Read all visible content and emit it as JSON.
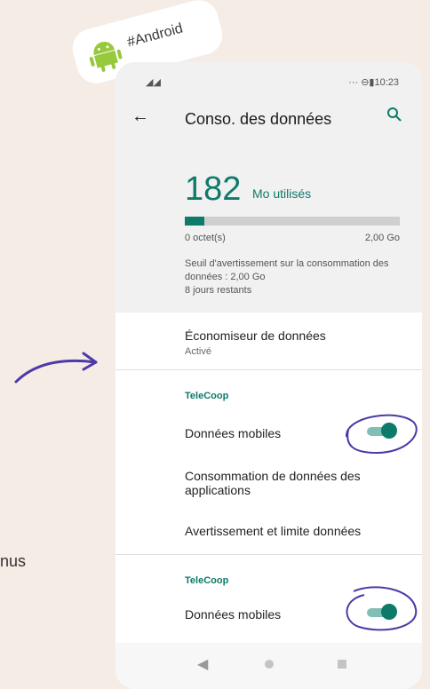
{
  "sticker": {
    "label": "#Android"
  },
  "side_text": "nus",
  "status": {
    "right": "··· ⊖▮10:23",
    "signal": "◢◢"
  },
  "appbar": {
    "title": "Conso. des données"
  },
  "usage": {
    "amount": "182",
    "unit": "Mo utilisés",
    "progress_fraction": 0.09,
    "min_label": "0 octet(s)",
    "max_label": "2,00 Go",
    "warning": "Seuil d'avertissement sur la consommation des données : 2,00 Go",
    "days_left": "8 jours restants"
  },
  "saver": {
    "label": "Économiseur de données",
    "status": "Activé"
  },
  "section1": {
    "header": "TeleCoop",
    "mobile_data": "Données mobiles",
    "toggle_on": true
  },
  "app_usage": "Consommation de données des applications",
  "warning_limit": "Avertissement et limite données",
  "section2": {
    "header": "TeleCoop",
    "mobile_data": "Données mobiles",
    "toggle_on": true
  },
  "colors": {
    "accent": "#0d7a6a",
    "background": "#f6ece6",
    "annotation": "#4b3aa8"
  },
  "icons": [
    "android-icon",
    "back-arrow-icon",
    "search-icon",
    "nav-back-icon",
    "nav-home-icon",
    "nav-recent-icon"
  ]
}
